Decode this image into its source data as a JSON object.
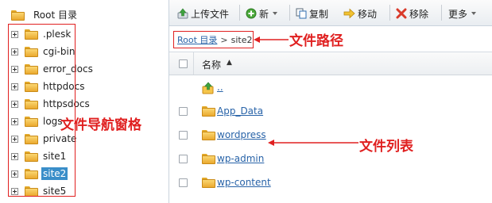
{
  "tree": {
    "root_label": "Root 目录",
    "items": [
      {
        "label": ".plesk",
        "selected": false
      },
      {
        "label": "cgi-bin",
        "selected": false
      },
      {
        "label": "error_docs",
        "selected": false
      },
      {
        "label": "httpdocs",
        "selected": false
      },
      {
        "label": "httpsdocs",
        "selected": false
      },
      {
        "label": "logs",
        "selected": false
      },
      {
        "label": "private",
        "selected": false
      },
      {
        "label": "site1",
        "selected": false
      },
      {
        "label": "site2",
        "selected": true
      },
      {
        "label": "site5",
        "selected": false
      }
    ]
  },
  "toolbar": {
    "upload_label": "上传文件",
    "new_label": "新",
    "copy_label": "复制",
    "move_label": "移动",
    "remove_label": "移除",
    "more_label": "更多"
  },
  "path": {
    "root_link": "Root 目录",
    "separator": ">",
    "current": "site2"
  },
  "list": {
    "name_header": "名称",
    "sort_indicator": "▲",
    "parent_link": "..",
    "files": [
      "App_Data",
      "wordpress",
      "wp-admin",
      "wp-content"
    ]
  },
  "annotations": {
    "path_label": "文件路径",
    "nav_label": "文件导航窗格",
    "list_label": "文件列表"
  },
  "colors": {
    "annotation_red": "#e02020",
    "selection_blue": "#3a8ec9",
    "link_blue": "#2863a8",
    "folder_yellow": "#f5c54a"
  }
}
